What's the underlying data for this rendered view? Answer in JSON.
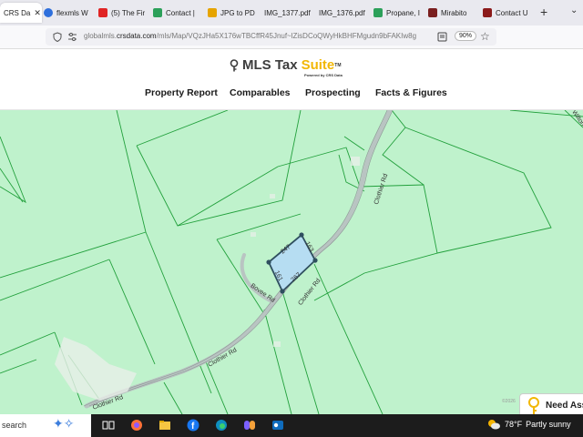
{
  "browser": {
    "tabs": [
      {
        "label": "CRS Da",
        "close": "✕",
        "icon_color": "#1a73e8",
        "active": true
      },
      {
        "label": "flexmls W",
        "icon_color": "#2e6fdc"
      },
      {
        "label": "(5) The Fir",
        "icon_color": "#e02424"
      },
      {
        "label": "Contact |",
        "icon_color": "#2ca05a"
      },
      {
        "label": "JPG to PD",
        "icon_color": "#e6a400"
      },
      {
        "label": "IMG_1377.pdf",
        "icon_color": "#888888"
      },
      {
        "label": "IMG_1376.pdf",
        "icon_color": "#888888"
      },
      {
        "label": "Propane, I",
        "icon_color": "#2ca05a"
      },
      {
        "label": "Mirabito",
        "icon_color": "#7a1f1f"
      },
      {
        "label": "Contact U",
        "icon_color": "#8b1a1a"
      }
    ],
    "new_tab": "+",
    "tab_list": "⌄",
    "url_prefix": "globalmls.",
    "url_domain": "crsdata.com",
    "url_path": "/mls/Map/VQzJHa5X176wTBCffR45Jnuf~lZisDCoQWyHkBHFMgudn9bFAKIw8g",
    "zoom": "90%"
  },
  "site": {
    "logo_text": "MLS Tax",
    "logo_accent": "Suite",
    "logo_tm": "TM",
    "logo_sub": "Powered by CRS Data",
    "nav": [
      "Property Report",
      "Comparables",
      "Prospecting",
      "Facts & Figures"
    ]
  },
  "map": {
    "roads": [
      "Clothier Rd",
      "Clothier Rd",
      "Clothier Rd",
      "Clothier Rd",
      "Bovee Rd",
      "Wilton"
    ],
    "dimensions": [
      "247",
      "163",
      "267",
      "161"
    ],
    "copyright": "©2026",
    "colors": {
      "land": "#bff2cc",
      "parcel_line": "#22a03c",
      "road": "#b9c4c2",
      "selected": "#b6ddf2"
    }
  },
  "help": {
    "label": "Need Ass"
  },
  "taskbar": {
    "search": "search",
    "weather_temp": "78°F",
    "weather_desc": "Partly sunny"
  }
}
